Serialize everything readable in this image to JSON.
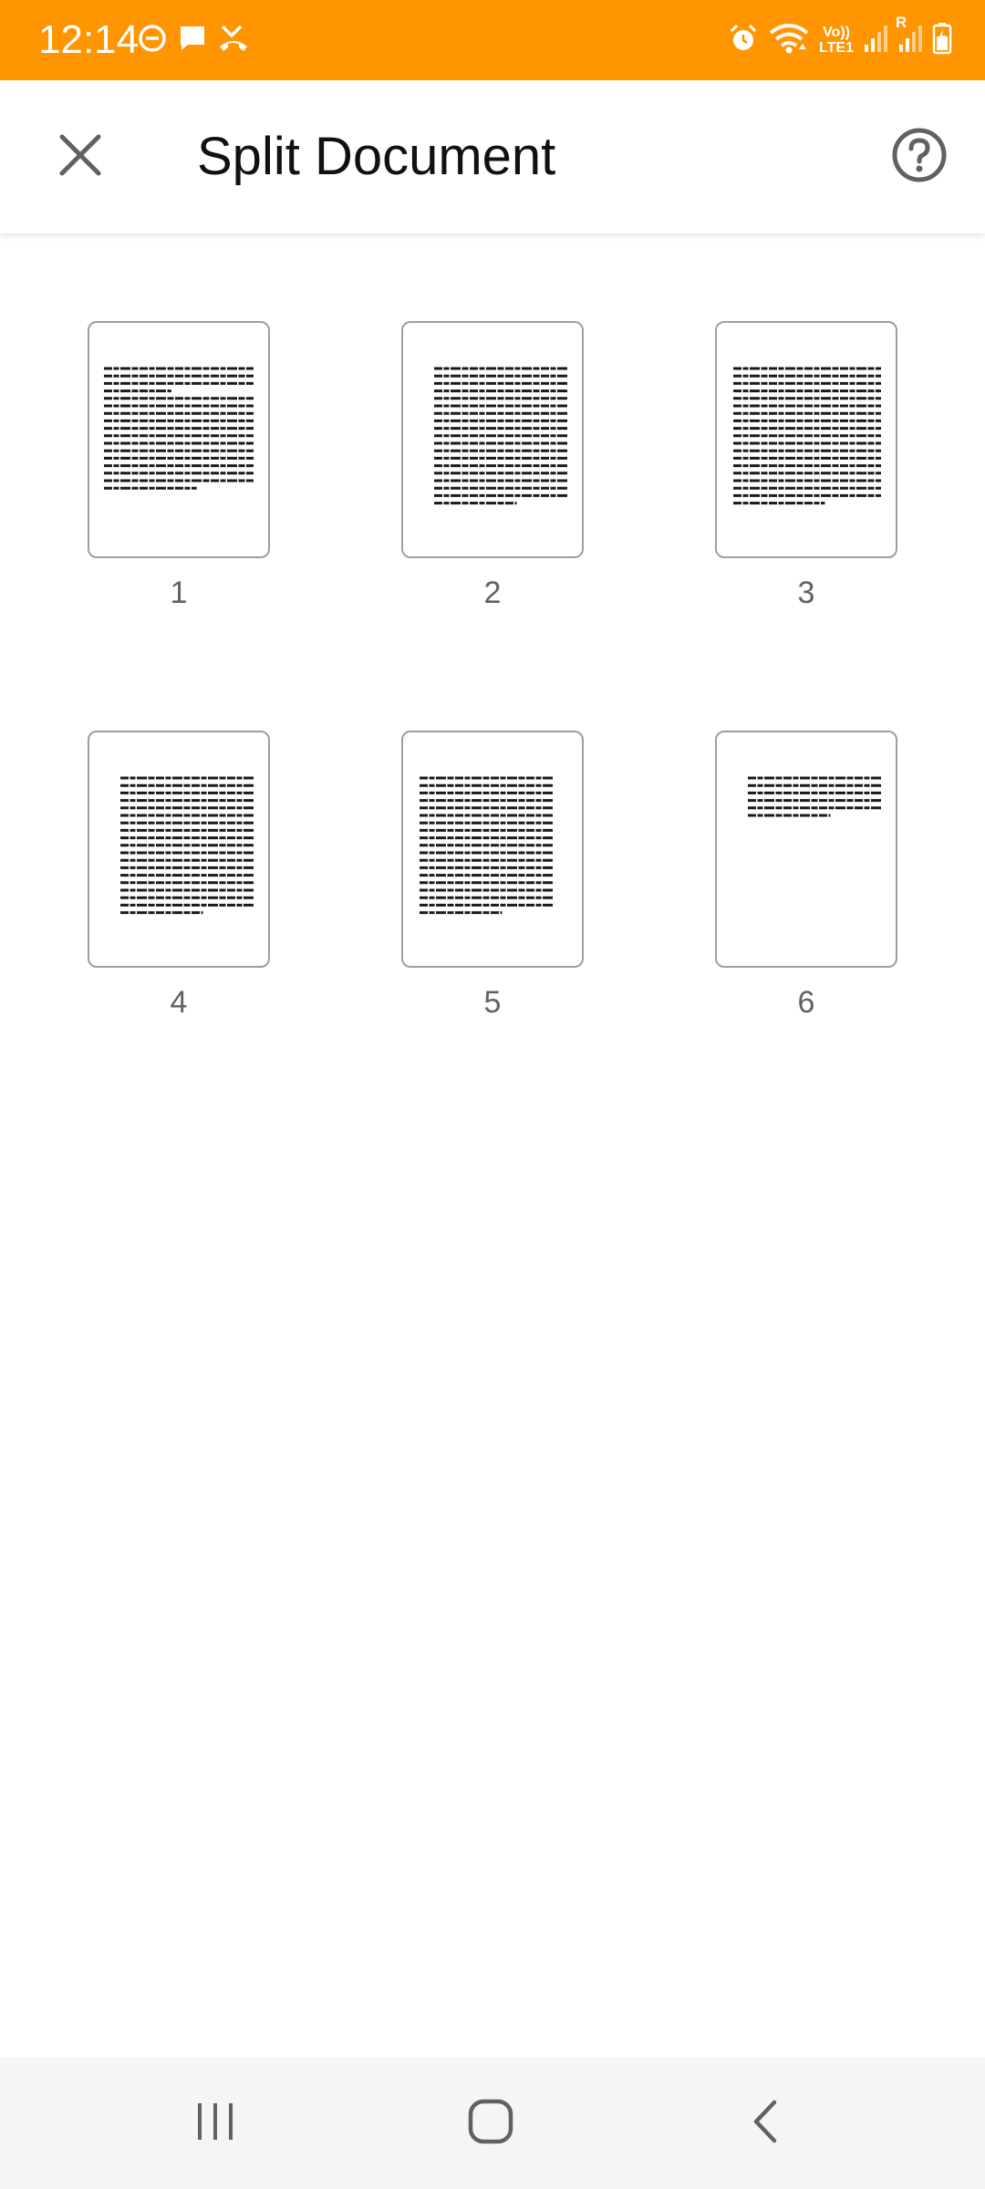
{
  "colors": {
    "status_bar": "#FF9500",
    "app_bar": "#FFFFFF",
    "title_text": "#111111",
    "icon_gray": "#616161",
    "thumb_border": "#9E9E9E",
    "nav_bar": "#F5F5F5"
  },
  "status_bar": {
    "time": "12:14",
    "lte_label_top": "Vo))",
    "lte_label_bottom": "LTE1",
    "sim_label": "R",
    "left_icons": [
      "do-not-disturb-icon",
      "chat-message-icon",
      "missed-call-icon"
    ],
    "right_icons": [
      "alarm-icon",
      "wifi-icon",
      "volte-icon",
      "signal-icon",
      "signal-roaming-icon",
      "battery-charging-icon"
    ]
  },
  "app_bar": {
    "title": "Split Document",
    "close_icon": "close-icon",
    "help_icon": "help-icon"
  },
  "pages": [
    {
      "number": "1"
    },
    {
      "number": "2"
    },
    {
      "number": "3"
    },
    {
      "number": "4"
    },
    {
      "number": "5"
    },
    {
      "number": "6"
    }
  ],
  "nav_bar": {
    "icons": [
      "recent-apps-icon",
      "home-icon",
      "back-icon"
    ]
  }
}
